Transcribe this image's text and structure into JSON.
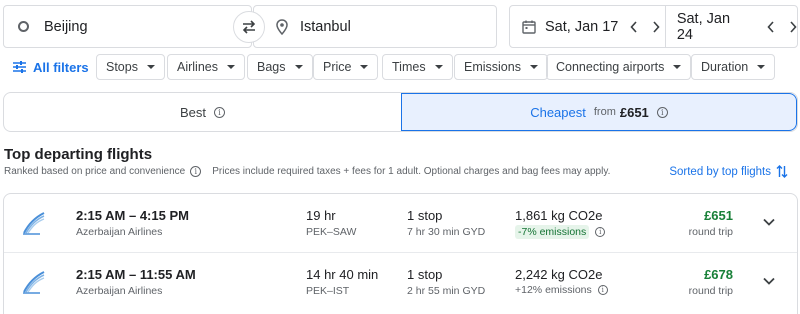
{
  "search": {
    "origin": "Beijing",
    "destination": "Istanbul",
    "depart_date": "Sat, Jan 17",
    "return_date": "Sat, Jan 24"
  },
  "filters": {
    "all_filters": "All filters",
    "chips": [
      "Stops",
      "Airlines",
      "Bags",
      "Price",
      "Times",
      "Emissions",
      "Connecting airports",
      "Duration"
    ]
  },
  "tabs": {
    "best": "Best",
    "cheapest": "Cheapest",
    "cheapest_from": "from",
    "cheapest_price": "£651"
  },
  "results": {
    "title": "Top departing flights",
    "ranked_note": "Ranked based on price and convenience",
    "prices_note": "Prices include required taxes + fees for 1 adult. Optional charges and bag fees may apply.",
    "sorted_label": "Sorted by top flights",
    "flights": [
      {
        "times": "2:15 AM – 4:15 PM",
        "airline": "Azerbaijan Airlines",
        "duration": "19 hr",
        "route": "PEK–SAW",
        "stops": "1 stop",
        "layover": "7 hr 30 min GYD",
        "co2": "1,861 kg CO2e",
        "emissions": "-7% emissions",
        "price": "£651",
        "trip_type": "round trip"
      },
      {
        "times": "2:15 AM – 11:55 AM",
        "airline": "Azerbaijan Airlines",
        "duration": "14 hr 40 min",
        "route": "PEK–IST",
        "stops": "1 stop",
        "layover": "2 hr 55 min GYD",
        "co2": "2,242 kg CO2e",
        "emissions": "+12% emissions",
        "price": "£678",
        "trip_type": "round trip"
      }
    ]
  },
  "icons": {
    "origin": "circle-icon",
    "destination": "location-pin-icon",
    "swap": "swap-arrows-icon",
    "date": "calendar-icon",
    "prev": "chevron-left-icon",
    "next": "chevron-right-icon",
    "filters": "sliders-icon",
    "info": "info-icon",
    "sort": "sort-arrows-icon",
    "expand": "chevron-down-icon",
    "airline_logo": "azerbaijan-airlines-logo"
  },
  "colors": {
    "accent": "#1a73e8",
    "price": "#188038",
    "selected_tab_bg": "#e8f0fe",
    "emissions_badge_bg": "#e6f4ea",
    "emissions_badge_text": "#137333"
  }
}
